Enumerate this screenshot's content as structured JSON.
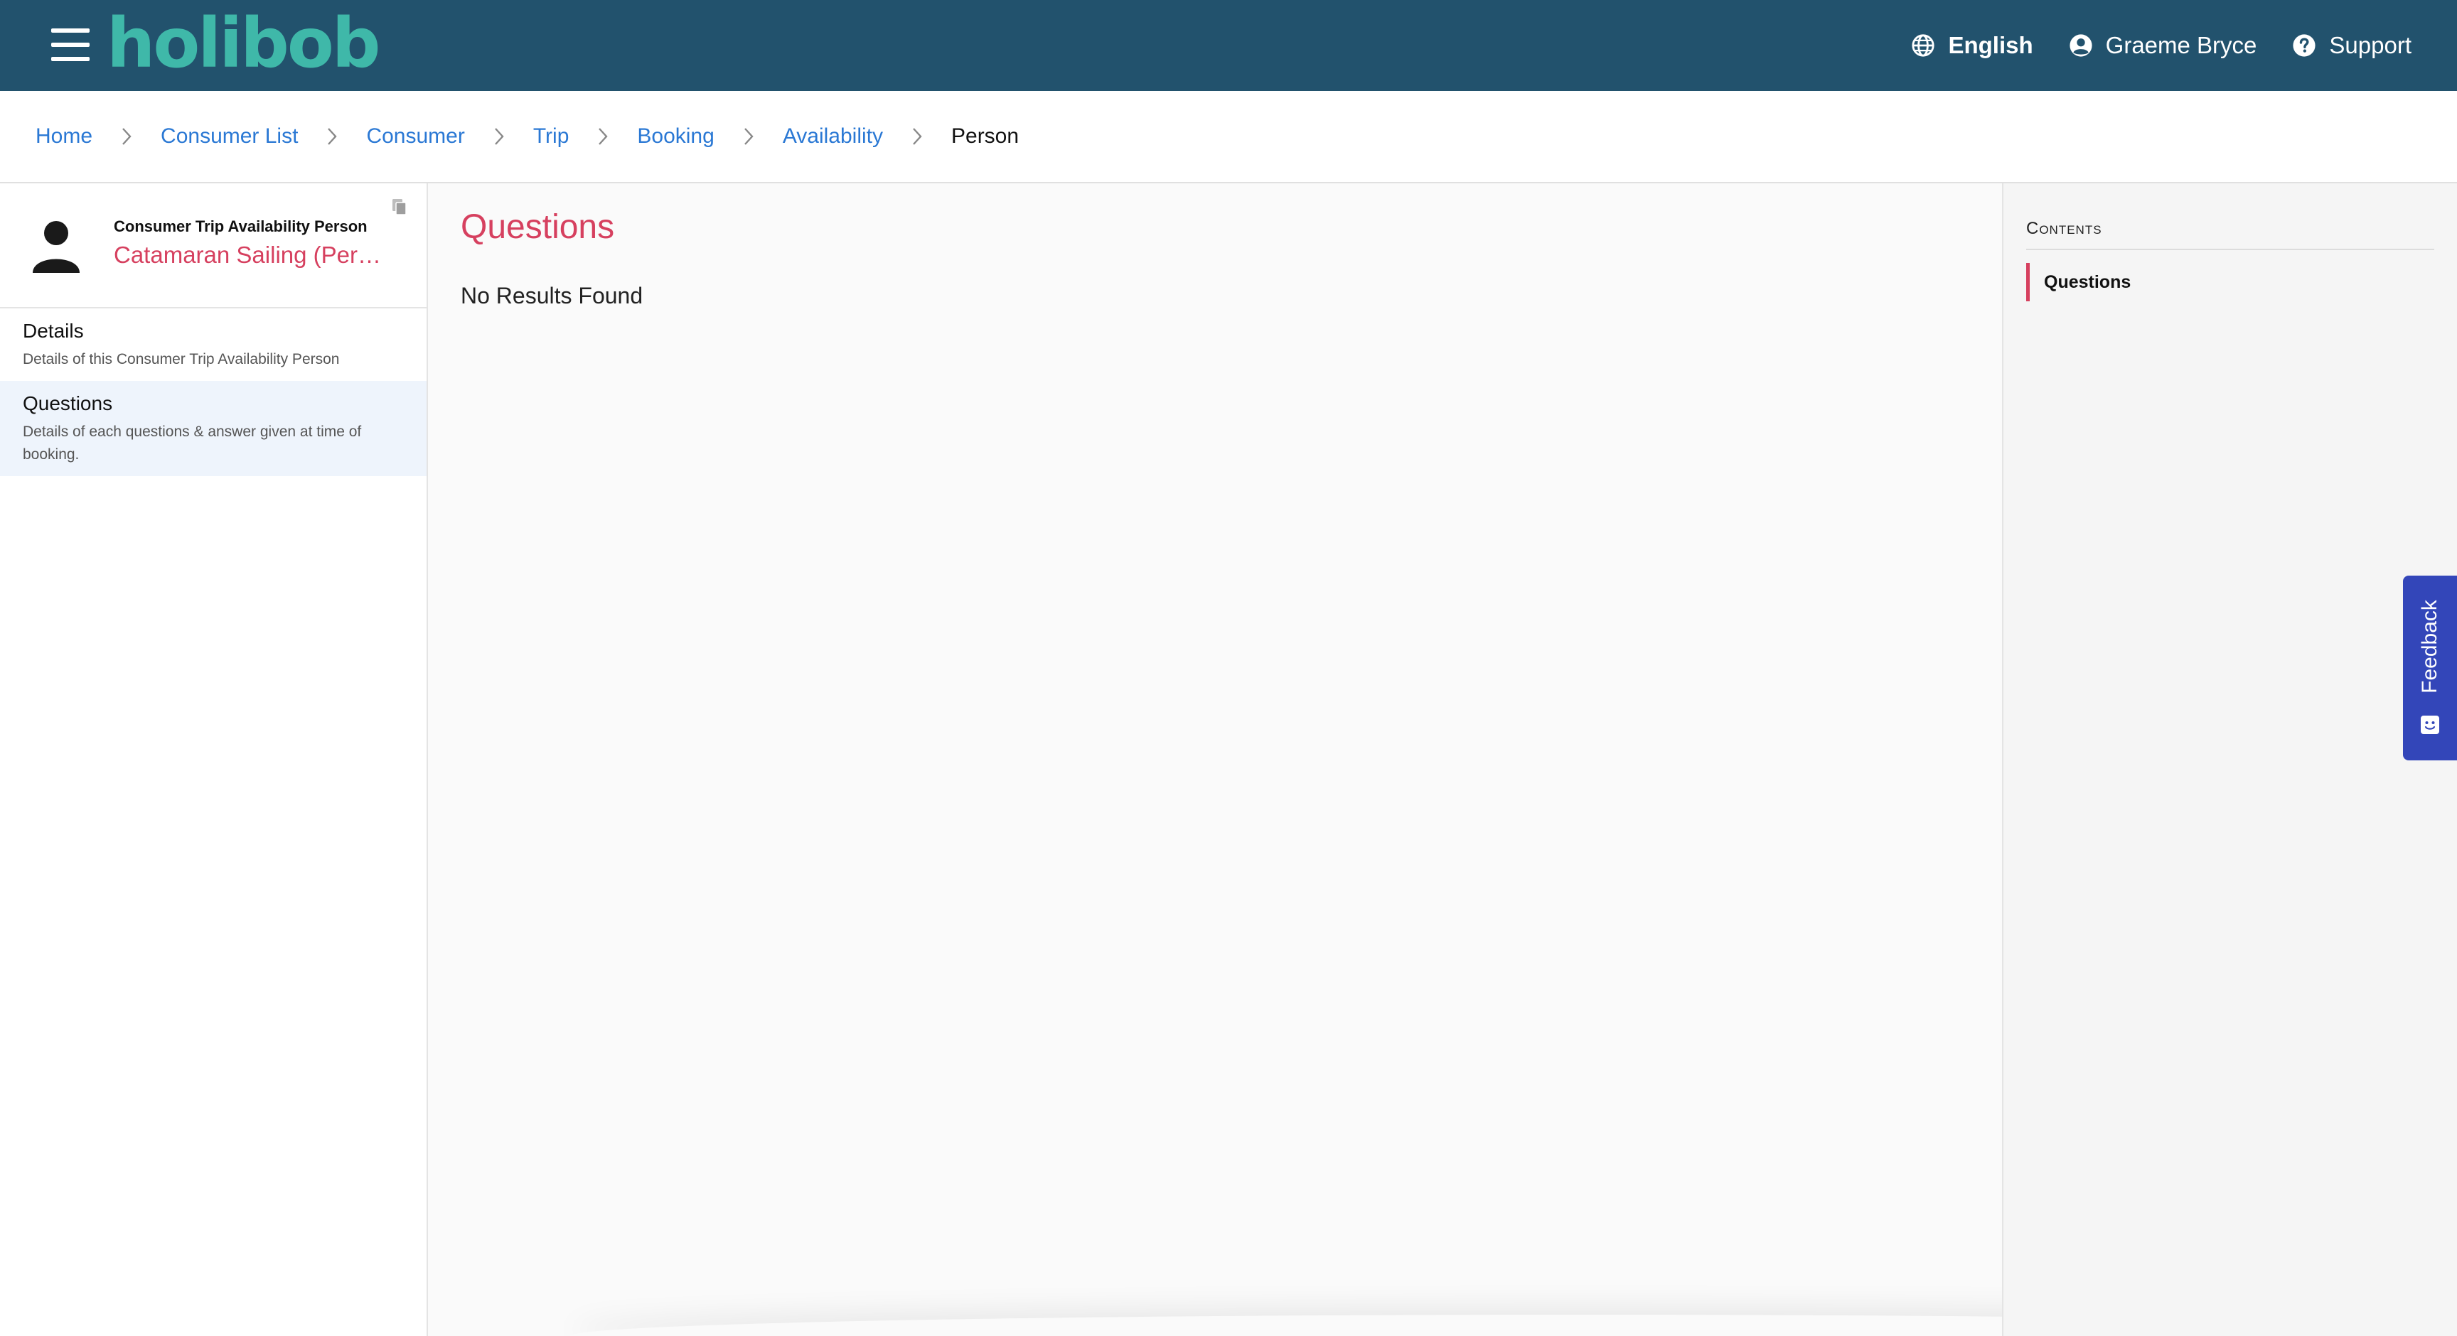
{
  "header": {
    "logo_text": "holibob",
    "language": "English",
    "user": "Graeme Bryce",
    "support": "Support"
  },
  "breadcrumb": [
    "Home",
    "Consumer List",
    "Consumer",
    "Trip",
    "Booking",
    "Availability",
    "Person"
  ],
  "sidebar": {
    "entity_type": "Consumer Trip Availability Person",
    "entity_name": "Catamaran Sailing (Per…",
    "items": [
      {
        "title": "Details",
        "description": "Details of this Consumer Trip Availability Person"
      },
      {
        "title": "Questions",
        "description": "Details of each questions & answer given at time of booking."
      }
    ]
  },
  "main": {
    "title": "Questions",
    "empty_message": "No Results Found"
  },
  "contents": {
    "heading": "Contents",
    "items": [
      "Questions"
    ]
  },
  "feedback": {
    "label": "Feedback"
  },
  "colors": {
    "header_bg": "#22526d",
    "logo": "#3fb8a9",
    "accent_pink": "#d6405f",
    "link_blue": "#2a78d4",
    "feedback_bg": "#3346b9"
  }
}
